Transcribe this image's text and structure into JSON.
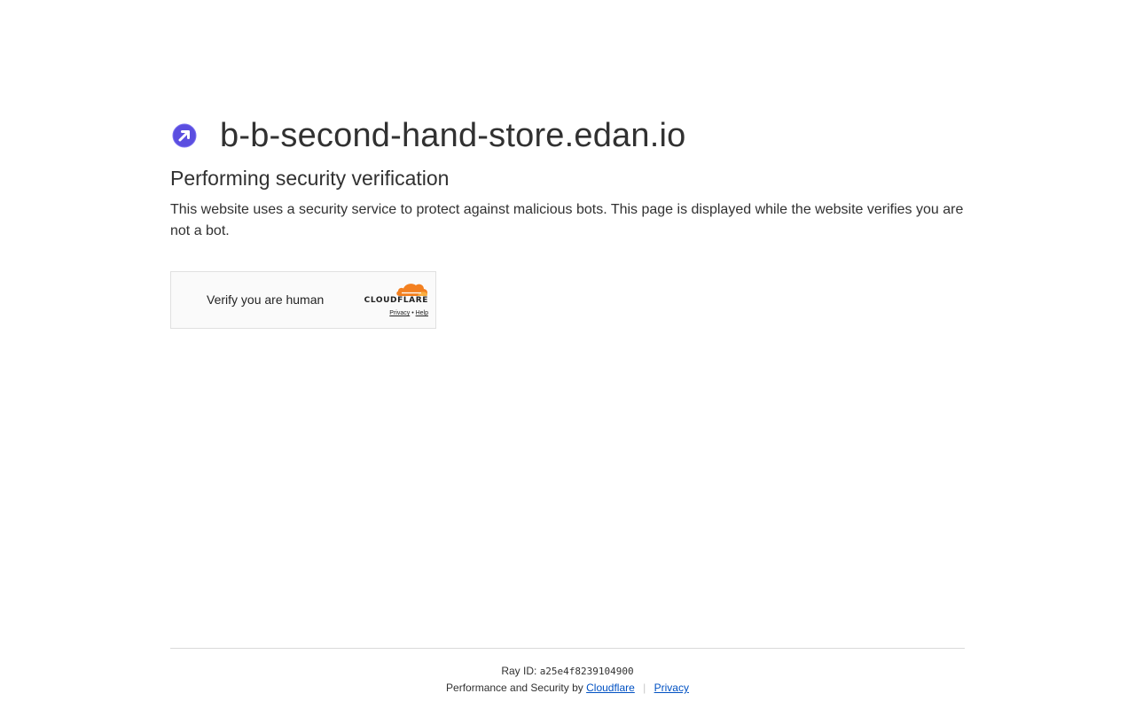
{
  "site": {
    "icon": "edan-logo-icon",
    "name": "b-b-second-hand-store.edan.io"
  },
  "heading": "Performing security verification",
  "description": "This website uses a security service to protect against malicious bots. This page is displayed while the website verifies you are not a bot.",
  "widget": {
    "label": "Verify you are human",
    "brand": "CLOUDFLARE",
    "privacy_link": "Privacy",
    "separator": "•",
    "help_link": "Help"
  },
  "footer": {
    "ray_label": "Ray ID:",
    "ray_id": "a25e4f8239104900",
    "perf_text": "Performance and Security by",
    "cloudflare_link": "Cloudflare",
    "divider": "|",
    "privacy_link": "Privacy"
  },
  "colors": {
    "link": "#0051c3",
    "cloudflare_orange": "#f38020",
    "logo_purple": "#5b4ee0"
  }
}
